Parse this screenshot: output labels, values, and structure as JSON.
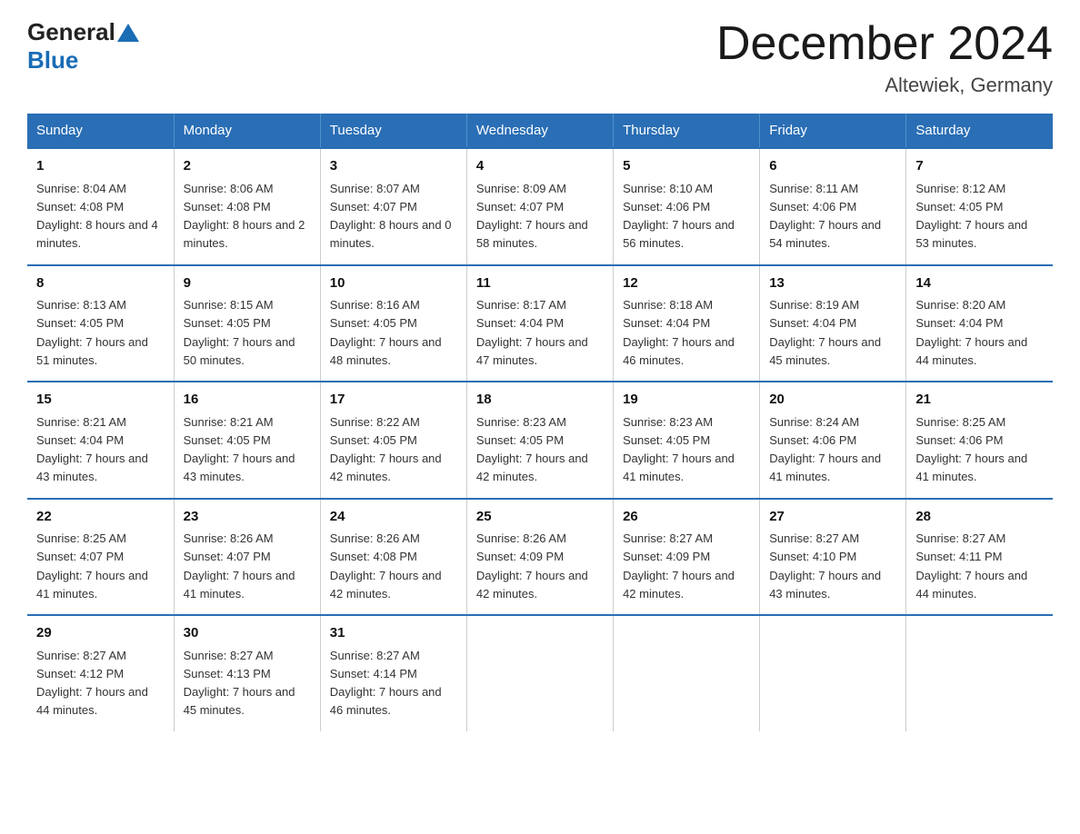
{
  "header": {
    "logo_general": "General",
    "logo_blue": "Blue",
    "month_title": "December 2024",
    "location": "Altewiek, Germany"
  },
  "days_of_week": [
    "Sunday",
    "Monday",
    "Tuesday",
    "Wednesday",
    "Thursday",
    "Friday",
    "Saturday"
  ],
  "weeks": [
    [
      {
        "num": "1",
        "sunrise": "Sunrise: 8:04 AM",
        "sunset": "Sunset: 4:08 PM",
        "daylight": "Daylight: 8 hours and 4 minutes."
      },
      {
        "num": "2",
        "sunrise": "Sunrise: 8:06 AM",
        "sunset": "Sunset: 4:08 PM",
        "daylight": "Daylight: 8 hours and 2 minutes."
      },
      {
        "num": "3",
        "sunrise": "Sunrise: 8:07 AM",
        "sunset": "Sunset: 4:07 PM",
        "daylight": "Daylight: 8 hours and 0 minutes."
      },
      {
        "num": "4",
        "sunrise": "Sunrise: 8:09 AM",
        "sunset": "Sunset: 4:07 PM",
        "daylight": "Daylight: 7 hours and 58 minutes."
      },
      {
        "num": "5",
        "sunrise": "Sunrise: 8:10 AM",
        "sunset": "Sunset: 4:06 PM",
        "daylight": "Daylight: 7 hours and 56 minutes."
      },
      {
        "num": "6",
        "sunrise": "Sunrise: 8:11 AM",
        "sunset": "Sunset: 4:06 PM",
        "daylight": "Daylight: 7 hours and 54 minutes."
      },
      {
        "num": "7",
        "sunrise": "Sunrise: 8:12 AM",
        "sunset": "Sunset: 4:05 PM",
        "daylight": "Daylight: 7 hours and 53 minutes."
      }
    ],
    [
      {
        "num": "8",
        "sunrise": "Sunrise: 8:13 AM",
        "sunset": "Sunset: 4:05 PM",
        "daylight": "Daylight: 7 hours and 51 minutes."
      },
      {
        "num": "9",
        "sunrise": "Sunrise: 8:15 AM",
        "sunset": "Sunset: 4:05 PM",
        "daylight": "Daylight: 7 hours and 50 minutes."
      },
      {
        "num": "10",
        "sunrise": "Sunrise: 8:16 AM",
        "sunset": "Sunset: 4:05 PM",
        "daylight": "Daylight: 7 hours and 48 minutes."
      },
      {
        "num": "11",
        "sunrise": "Sunrise: 8:17 AM",
        "sunset": "Sunset: 4:04 PM",
        "daylight": "Daylight: 7 hours and 47 minutes."
      },
      {
        "num": "12",
        "sunrise": "Sunrise: 8:18 AM",
        "sunset": "Sunset: 4:04 PM",
        "daylight": "Daylight: 7 hours and 46 minutes."
      },
      {
        "num": "13",
        "sunrise": "Sunrise: 8:19 AM",
        "sunset": "Sunset: 4:04 PM",
        "daylight": "Daylight: 7 hours and 45 minutes."
      },
      {
        "num": "14",
        "sunrise": "Sunrise: 8:20 AM",
        "sunset": "Sunset: 4:04 PM",
        "daylight": "Daylight: 7 hours and 44 minutes."
      }
    ],
    [
      {
        "num": "15",
        "sunrise": "Sunrise: 8:21 AM",
        "sunset": "Sunset: 4:04 PM",
        "daylight": "Daylight: 7 hours and 43 minutes."
      },
      {
        "num": "16",
        "sunrise": "Sunrise: 8:21 AM",
        "sunset": "Sunset: 4:05 PM",
        "daylight": "Daylight: 7 hours and 43 minutes."
      },
      {
        "num": "17",
        "sunrise": "Sunrise: 8:22 AM",
        "sunset": "Sunset: 4:05 PM",
        "daylight": "Daylight: 7 hours and 42 minutes."
      },
      {
        "num": "18",
        "sunrise": "Sunrise: 8:23 AM",
        "sunset": "Sunset: 4:05 PM",
        "daylight": "Daylight: 7 hours and 42 minutes."
      },
      {
        "num": "19",
        "sunrise": "Sunrise: 8:23 AM",
        "sunset": "Sunset: 4:05 PM",
        "daylight": "Daylight: 7 hours and 41 minutes."
      },
      {
        "num": "20",
        "sunrise": "Sunrise: 8:24 AM",
        "sunset": "Sunset: 4:06 PM",
        "daylight": "Daylight: 7 hours and 41 minutes."
      },
      {
        "num": "21",
        "sunrise": "Sunrise: 8:25 AM",
        "sunset": "Sunset: 4:06 PM",
        "daylight": "Daylight: 7 hours and 41 minutes."
      }
    ],
    [
      {
        "num": "22",
        "sunrise": "Sunrise: 8:25 AM",
        "sunset": "Sunset: 4:07 PM",
        "daylight": "Daylight: 7 hours and 41 minutes."
      },
      {
        "num": "23",
        "sunrise": "Sunrise: 8:26 AM",
        "sunset": "Sunset: 4:07 PM",
        "daylight": "Daylight: 7 hours and 41 minutes."
      },
      {
        "num": "24",
        "sunrise": "Sunrise: 8:26 AM",
        "sunset": "Sunset: 4:08 PM",
        "daylight": "Daylight: 7 hours and 42 minutes."
      },
      {
        "num": "25",
        "sunrise": "Sunrise: 8:26 AM",
        "sunset": "Sunset: 4:09 PM",
        "daylight": "Daylight: 7 hours and 42 minutes."
      },
      {
        "num": "26",
        "sunrise": "Sunrise: 8:27 AM",
        "sunset": "Sunset: 4:09 PM",
        "daylight": "Daylight: 7 hours and 42 minutes."
      },
      {
        "num": "27",
        "sunrise": "Sunrise: 8:27 AM",
        "sunset": "Sunset: 4:10 PM",
        "daylight": "Daylight: 7 hours and 43 minutes."
      },
      {
        "num": "28",
        "sunrise": "Sunrise: 8:27 AM",
        "sunset": "Sunset: 4:11 PM",
        "daylight": "Daylight: 7 hours and 44 minutes."
      }
    ],
    [
      {
        "num": "29",
        "sunrise": "Sunrise: 8:27 AM",
        "sunset": "Sunset: 4:12 PM",
        "daylight": "Daylight: 7 hours and 44 minutes."
      },
      {
        "num": "30",
        "sunrise": "Sunrise: 8:27 AM",
        "sunset": "Sunset: 4:13 PM",
        "daylight": "Daylight: 7 hours and 45 minutes."
      },
      {
        "num": "31",
        "sunrise": "Sunrise: 8:27 AM",
        "sunset": "Sunset: 4:14 PM",
        "daylight": "Daylight: 7 hours and 46 minutes."
      },
      {
        "num": "",
        "sunrise": "",
        "sunset": "",
        "daylight": ""
      },
      {
        "num": "",
        "sunrise": "",
        "sunset": "",
        "daylight": ""
      },
      {
        "num": "",
        "sunrise": "",
        "sunset": "",
        "daylight": ""
      },
      {
        "num": "",
        "sunrise": "",
        "sunset": "",
        "daylight": ""
      }
    ]
  ]
}
